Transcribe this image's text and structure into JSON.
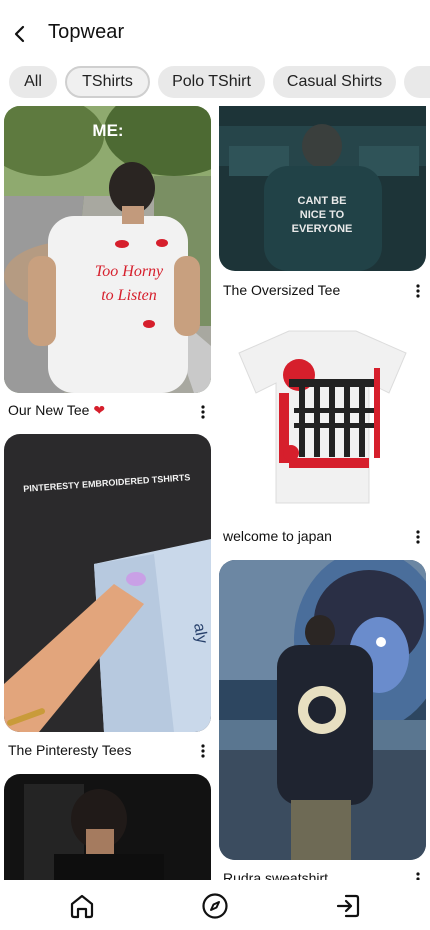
{
  "header": {
    "title": "Topwear",
    "back_icon": "chevron-left-icon"
  },
  "chips": [
    {
      "label": "All",
      "selected": false
    },
    {
      "label": "TShirts",
      "selected": true
    },
    {
      "label": "Polo TShirt",
      "selected": false
    },
    {
      "label": "Casual Shirts",
      "selected": false
    },
    {
      "label": "",
      "selected": false
    }
  ],
  "pins": {
    "our_new_tee": {
      "title": "Our New Tee",
      "overlay_top": "ME:",
      "print_text": "Too Horny to Listen",
      "emoji": "heart"
    },
    "oversized_tee": {
      "title": "The Oversized Tee",
      "print_text": "CANT BE NICE TO EVERYONE"
    },
    "welcome_japan": {
      "title": "welcome to japan"
    },
    "pinteresty_tees": {
      "title": "The Pinteresty Tees",
      "banner": "PINTERESTY EMBROIDERED TSHIRTS"
    },
    "rudra_sweatshirt": {
      "title": "Rudra sweatshirt"
    },
    "bottom_left": {
      "title": ""
    }
  },
  "nav": {
    "home_icon": "home-icon",
    "explore_icon": "compass-icon",
    "logout_icon": "sign-out-icon"
  },
  "colors": {
    "accent_red": "#d61f2c",
    "chip_bg": "#e9e9e9"
  }
}
